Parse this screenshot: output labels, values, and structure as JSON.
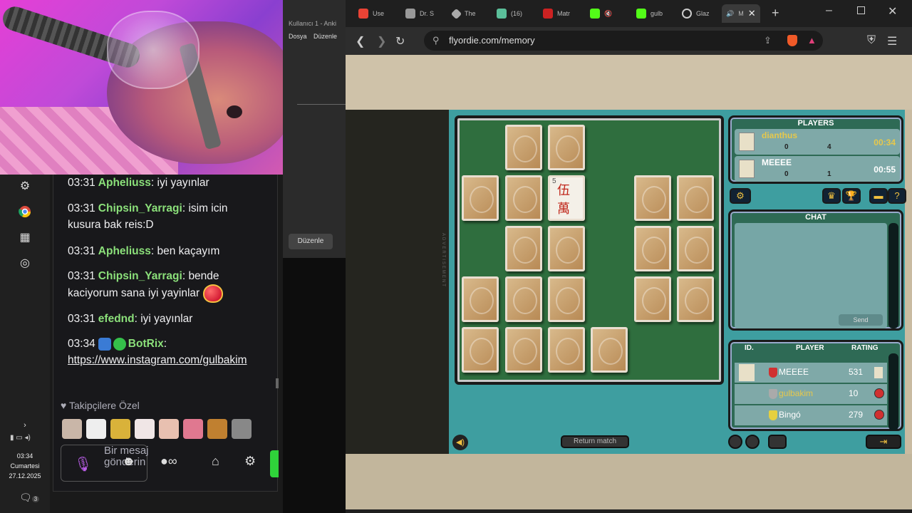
{
  "chat": {
    "messages": [
      {
        "time": "03:31",
        "user": "Apheliuss",
        "text": "iyi yayınlar"
      },
      {
        "time": "03:31",
        "user": "Chipsin_Yarragi",
        "text": "isim icin kusura bak reis:D"
      },
      {
        "time": "03:31",
        "user": "Apheliuss",
        "text": "ben kaçayım"
      },
      {
        "time": "03:31",
        "user": "Chipsin_Yarragi",
        "text": "bende kaciyorum sana iyi yayinlar"
      },
      {
        "time": "03:31",
        "user": "efednd",
        "text": "iyi yayınlar"
      },
      {
        "time": "03:34",
        "user": "BotRix",
        "text": "https://www.instagram.com/gulbakim"
      }
    ],
    "followers_label": "Takipçilere Özel",
    "input_placeholder": "Bir mesaj gönderin"
  },
  "taskbar": {
    "time": "03:34",
    "day": "Cumartesi",
    "date": "27.12.2025",
    "notif_count": "3"
  },
  "anki": {
    "title": "Kullanıcı 1 - Anki",
    "menu_file": "Dosya",
    "menu_edit": "Düzenle",
    "edit_button": "Düzenle"
  },
  "browser": {
    "tabs": [
      "Use",
      "Dr. S",
      "The",
      "(16)",
      "Matr",
      "",
      "gulb",
      "Glaz",
      "M"
    ],
    "url": "flyordie.com/memory"
  },
  "game": {
    "players_title": "PLAYERS",
    "players": [
      {
        "name": "dianthus",
        "score_a": "0",
        "score_b": "4",
        "time": "00:34",
        "color": "#e6c84c"
      },
      {
        "name": "MEEEE",
        "score_a": "0",
        "score_b": "1",
        "time": "00:55",
        "color": "#ffffff"
      }
    ],
    "chat_title": "CHAT",
    "send_label": "Send",
    "rating_headers": {
      "id": "ID.",
      "player": "PLAYER",
      "rating": "RATING"
    },
    "rating_rows": [
      {
        "name": "MEEEE",
        "rating": "531",
        "color": "#ffffff",
        "shield": "#d03030"
      },
      {
        "name": "gulbakim",
        "rating": "10",
        "color": "#e6c84c",
        "shield": "#aaaaaa"
      },
      {
        "name": "Bingó",
        "rating": "279",
        "color": "#ffffff",
        "shield": "#e6d040"
      }
    ],
    "return_label": "Return match",
    "advertisement": "ADVERTISEMENT",
    "face_card": {
      "number": "5",
      "glyph_top": "伍",
      "glyph_bottom": "萬"
    }
  }
}
